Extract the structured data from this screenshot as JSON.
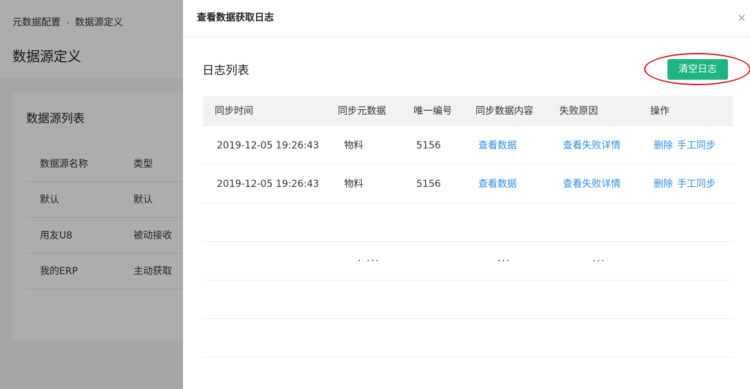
{
  "background": {
    "breadcrumb": [
      "元数据配置",
      "数据源定义"
    ],
    "breadcrumb_sep": "›",
    "page_title": "数据源定义",
    "card_title": "数据源列表",
    "table_headers": [
      "数据源名称",
      "类型"
    ],
    "rows": [
      {
        "name": "默认",
        "type": "默认"
      },
      {
        "name": "用友U8",
        "type": "被动接收"
      },
      {
        "name": "我的ERP",
        "type": "主动获取"
      }
    ]
  },
  "drawer": {
    "title": "查看数据获取日志",
    "close_glyph": "×",
    "section_title": "日志列表",
    "clear_button": "清空日志",
    "highlight_color": "#d9191e",
    "table": {
      "headers": [
        "同步时间",
        "同步元数据",
        "唯一编号",
        "同步数据内容",
        "失败原因",
        "操作"
      ],
      "rows": [
        {
          "time": "2019-12-05 19:26:43",
          "meta": "物料",
          "id": "5156",
          "content": "查看数据",
          "reason": "查看失败详情",
          "delete": "删除",
          "manual": "手工同步"
        },
        {
          "time": "2019-12-05 19:26:43",
          "meta": "物料",
          "id": "5156",
          "content": "查看数据",
          "reason": "查看失败详情",
          "delete": "删除",
          "manual": "手工同步"
        }
      ],
      "placeholder_dots": [
        "· ···",
        "···",
        "···"
      ]
    },
    "colors": {
      "button_green": "#1fb57e",
      "link_blue": "#2f8ee5"
    }
  }
}
